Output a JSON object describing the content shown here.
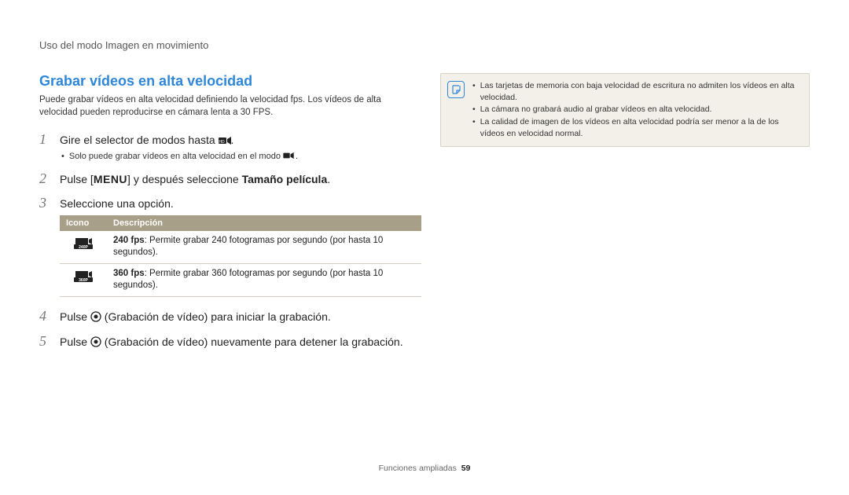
{
  "chapter": "Uso del modo Imagen en movimiento",
  "section_title": "Grabar vídeos en alta velocidad",
  "intro": "Puede grabar vídeos en alta velocidad definiendo la velocidad fps. Los vídeos de alta velocidad pueden reproducirse en cámara lenta a 30 FPS.",
  "steps": {
    "s1": {
      "num": "1",
      "text_pre": "Gire el selector de modos hasta ",
      "text_post": "."
    },
    "s1_note_pre": "Solo puede grabar vídeos en alta velocidad en el modo ",
    "s1_note_post": ".",
    "s2": {
      "num": "2",
      "text_pre": "Pulse [",
      "menu": "MENU",
      "text_mid": "] y después seleccione ",
      "bold": "Tamaño película",
      "text_post": "."
    },
    "s3": {
      "num": "3",
      "text": "Seleccione una opción."
    },
    "s4": {
      "num": "4",
      "text_pre": "Pulse ",
      "text_post": " (Grabación de vídeo) para iniciar la grabación."
    },
    "s5": {
      "num": "5",
      "text_pre": "Pulse ",
      "text_post": " (Grabación de vídeo) nuevamente para detener la grabación."
    }
  },
  "table": {
    "headers": {
      "icon": "Icono",
      "desc": "Descripción"
    },
    "rows": [
      {
        "icon_label": "240P",
        "bold": "240 fps",
        "text": ": Permite grabar 240 fotogramas por segundo (por hasta 10 segundos)."
      },
      {
        "icon_label": "360P",
        "bold": "360 fps",
        "text": ": Permite grabar 360 fotogramas por segundo (por hasta 10 segundos)."
      }
    ]
  },
  "notes": [
    "Las tarjetas de memoria con baja velocidad de escritura no admiten los vídeos en alta velocidad.",
    "La cámara no grabará audio al grabar vídeos en alta velocidad.",
    "La calidad de imagen de los vídeos en alta velocidad podría ser menor a la de los vídeos en velocidad normal."
  ],
  "footer": {
    "label": "Funciones ampliadas",
    "page": "59"
  }
}
